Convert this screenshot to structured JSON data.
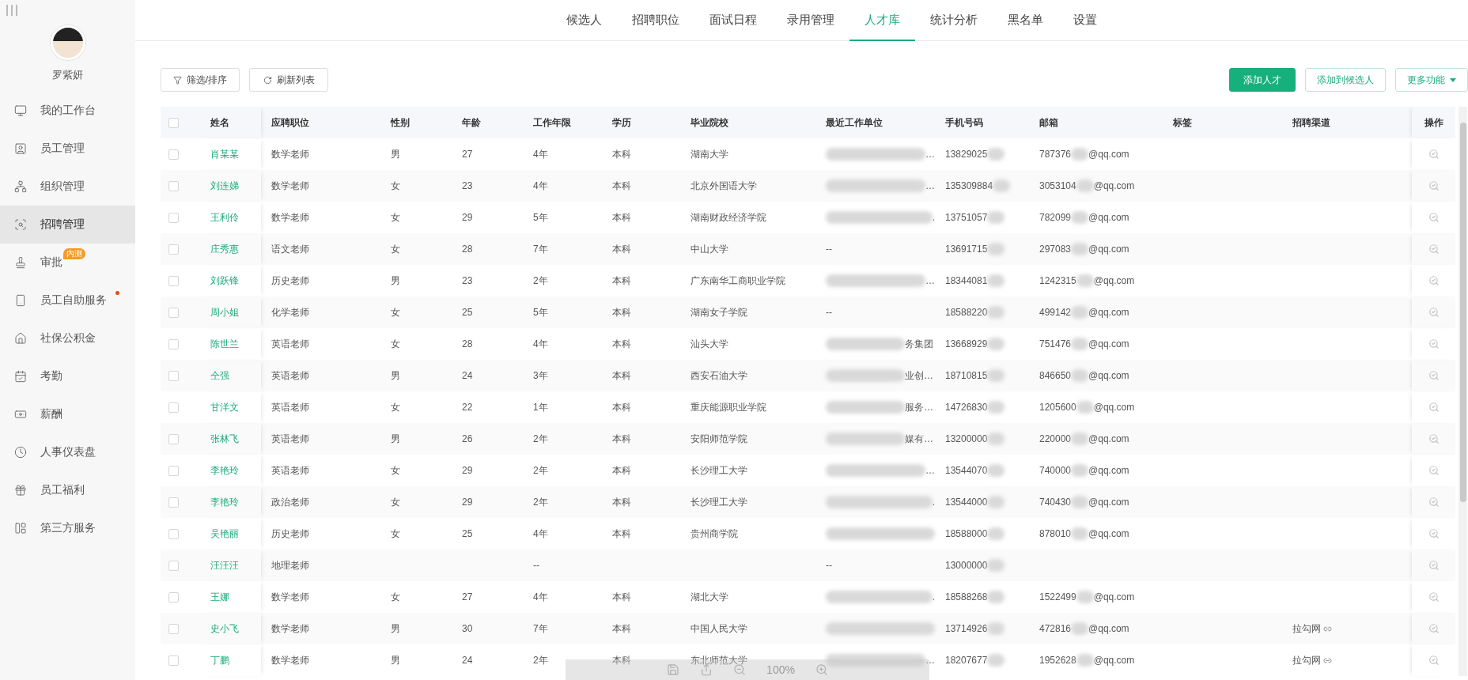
{
  "sidebar": {
    "user": {
      "name": "罗紫妍"
    },
    "items": [
      {
        "label": "我的工作台",
        "selected": false
      },
      {
        "label": "员工管理",
        "selected": false
      },
      {
        "label": "组织管理",
        "selected": false
      },
      {
        "label": "招聘管理",
        "selected": true
      },
      {
        "label": "审批",
        "selected": false,
        "badge": "内测"
      },
      {
        "label": "员工自助服务",
        "selected": false,
        "dot": true
      },
      {
        "label": "社保公积金",
        "selected": false
      },
      {
        "label": "考勤",
        "selected": false
      },
      {
        "label": "薪酬",
        "selected": false
      },
      {
        "label": "人事仪表盘",
        "selected": false
      },
      {
        "label": "员工福利",
        "selected": false
      },
      {
        "label": "第三方服务",
        "selected": false
      }
    ]
  },
  "tabs": [
    {
      "label": "候选人",
      "selected": false
    },
    {
      "label": "招聘职位",
      "selected": false
    },
    {
      "label": "面试日程",
      "selected": false
    },
    {
      "label": "录用管理",
      "selected": false
    },
    {
      "label": "人才库",
      "selected": true
    },
    {
      "label": "统计分析",
      "selected": false
    },
    {
      "label": "黑名单",
      "selected": false
    },
    {
      "label": "设置",
      "selected": false
    }
  ],
  "toolbar": {
    "left": [
      {
        "label": "筛选/排序"
      },
      {
        "label": "刷新列表"
      }
    ],
    "right": [
      {
        "label": "添加人才",
        "kind": "primary"
      },
      {
        "label": "添加到候选人",
        "kind": "outline"
      },
      {
        "label": "更多功能",
        "kind": "dropdown"
      }
    ]
  },
  "table": {
    "header_checked": false,
    "columns": [
      "姓名",
      "应聘职位",
      "性别",
      "年龄",
      "工作年限",
      "学历",
      "毕业院校",
      "最近工作单位",
      "手机号码",
      "邮箱",
      "标签",
      "招聘渠道",
      "操作"
    ],
    "rows": [
      {
        "checked": false,
        "name": "肖某某",
        "position": "数学老师",
        "gender": "男",
        "age": "27",
        "years": "4年",
        "degree": "本科",
        "school": "湖南大学",
        "company": {
          "redacted": true,
          "text": "…"
        },
        "phone": "13829025",
        "email_user": "787376",
        "email_domain": "@qq.com"
      },
      {
        "checked": false,
        "name": "刘连娣",
        "position": "数学老师",
        "gender": "女",
        "age": "23",
        "years": "4年",
        "degree": "本科",
        "school": "北京外国语大学",
        "company": {
          "redacted": true,
          "text": "…"
        },
        "phone": "135309884",
        "email_user": "3053104",
        "email_domain": "@qq.com"
      },
      {
        "checked": false,
        "name": "王利伶",
        "position": "数学老师",
        "gender": "女",
        "age": "29",
        "years": "5年",
        "degree": "本科",
        "school": "湖南财政经济学院",
        "company": {
          "redacted": true,
          "text": "."
        },
        "phone": "13751057",
        "email_user": "782099",
        "email_domain": "@qq.com"
      },
      {
        "checked": false,
        "name": "庄秀惠",
        "position": "语文老师",
        "gender": "女",
        "age": "28",
        "years": "7年",
        "degree": "本科",
        "school": "中山大学",
        "company": {
          "redacted": false,
          "text": "--"
        },
        "phone": "13691715",
        "email_user": "297083",
        "email_domain": "@qq.com"
      },
      {
        "checked": false,
        "name": "刘跃锋",
        "position": "历史老师",
        "gender": "男",
        "age": "23",
        "years": "2年",
        "degree": "本科",
        "school": "广东南华工商职业学院",
        "company": {
          "redacted": true,
          "text": "…"
        },
        "phone": "18344081",
        "email_user": "1242315",
        "email_domain": "@qq.com"
      },
      {
        "checked": false,
        "name": "周小姐",
        "position": "化学老师",
        "gender": "女",
        "age": "25",
        "years": "5年",
        "degree": "本科",
        "school": "湖南女子学院",
        "company": {
          "redacted": false,
          "text": "--"
        },
        "phone": "18588220",
        "email_user": "499142",
        "email_domain": "@qq.com"
      },
      {
        "checked": false,
        "name": "陈世兰",
        "position": "英语老师",
        "gender": "女",
        "age": "28",
        "years": "4年",
        "degree": "本科",
        "school": "汕头大学",
        "company": {
          "redacted": true,
          "text": "务集团"
        },
        "phone": "13668929",
        "email_user": "751476",
        "email_domain": "@qq.com"
      },
      {
        "checked": false,
        "name": "仝强",
        "position": "英语老师",
        "gender": "男",
        "age": "24",
        "years": "3年",
        "degree": "本科",
        "school": "西安石油大学",
        "company": {
          "redacted": true,
          "text": "业创…"
        },
        "phone": "18710815",
        "email_user": "846650",
        "email_domain": "@qq.com"
      },
      {
        "checked": false,
        "name": "甘洋文",
        "position": "英语老师",
        "gender": "女",
        "age": "22",
        "years": "1年",
        "degree": "本科",
        "school": "重庆能源职业学院",
        "company": {
          "redacted": true,
          "text": "服务…"
        },
        "phone": "14726830",
        "email_user": "1205600",
        "email_domain": "@qq.com"
      },
      {
        "checked": false,
        "name": "张林飞",
        "position": "英语老师",
        "gender": "男",
        "age": "26",
        "years": "2年",
        "degree": "本科",
        "school": "安阳师范学院",
        "company": {
          "redacted": true,
          "text": "媒有…"
        },
        "phone": "13200000",
        "email_user": "220000",
        "email_domain": "@qq.com"
      },
      {
        "checked": false,
        "name": "李艳玲",
        "position": "英语老师",
        "gender": "女",
        "age": "29",
        "years": "2年",
        "degree": "本科",
        "school": "长沙理工大学",
        "company": {
          "redacted": true,
          "text": "…"
        },
        "phone": "13544070",
        "email_user": "740000",
        "email_domain": "@qq.com"
      },
      {
        "checked": false,
        "name": "李艳玲",
        "position": "政治老师",
        "gender": "女",
        "age": "29",
        "years": "2年",
        "degree": "本科",
        "school": "长沙理工大学",
        "company": {
          "redacted": true,
          "text": "."
        },
        "phone": "13544000",
        "email_user": "740430",
        "email_domain": "@qq.com"
      },
      {
        "checked": false,
        "name": "吴艳丽",
        "position": "历史老师",
        "gender": "女",
        "age": "25",
        "years": "4年",
        "degree": "本科",
        "school": "贵州商学院",
        "company": {
          "redacted": true
        },
        "phone": "18588000",
        "email_user": "878010",
        "email_domain": "@qq.com"
      },
      {
        "checked": false,
        "name": "汪汪汪",
        "position": "地理老师",
        "years": "--",
        "company": {
          "redacted": false,
          "text": "--"
        },
        "phone": "13000000"
      },
      {
        "checked": false,
        "name": "王娜",
        "position": "数学老师",
        "gender": "女",
        "age": "27",
        "years": "4年",
        "degree": "本科",
        "school": "湖北大学",
        "company": {
          "redacted": true,
          "text": "."
        },
        "phone": "18588268",
        "email_user": "1522499",
        "email_domain": "@qq.com"
      },
      {
        "checked": false,
        "name": "史小飞",
        "position": "数学老师",
        "gender": "男",
        "age": "30",
        "years": "7年",
        "degree": "本科",
        "school": "中国人民大学",
        "company": {
          "redacted": true
        },
        "phone": "13714926",
        "email_user": "472816",
        "email_domain": "@qq.com",
        "channel": "拉勾网"
      },
      {
        "checked": false,
        "name": "丁鹏",
        "position": "数学老师",
        "gender": "男",
        "age": "24",
        "years": "2年",
        "degree": "本科",
        "school": "东北师范大学",
        "company": {
          "redacted": true,
          "text": "…"
        },
        "phone": "18207677",
        "email_user": "1952628",
        "email_domain": "@qq.com",
        "channel": "拉勾网"
      }
    ]
  },
  "viewer_toolbar": {
    "zoom": "100%"
  }
}
